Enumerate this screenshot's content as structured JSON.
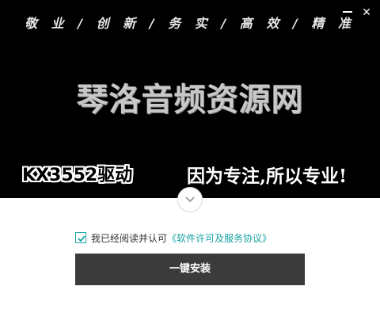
{
  "banner": {
    "slogan": "敬 业 / 创 新 / 务 实 / 高 效 / 精 准",
    "headline": "琴洛音频资源网",
    "driver_name": "KX3552驱动",
    "tagline": "因为专注,所以专业!",
    "background_color": "#000000"
  },
  "window_controls": {
    "minimize_icon": "minimize-icon",
    "close_icon": "close-icon",
    "close_glyph": "✕"
  },
  "expand_button": {
    "icon": "chevron-down-icon"
  },
  "agreement": {
    "checked": true,
    "text": "我已经阅读并认可",
    "link_text": "《软件许可及服务协议》",
    "link_color": "#1aa3a3"
  },
  "install_button": {
    "label": "一键安装",
    "color": "#3b3b3b"
  }
}
